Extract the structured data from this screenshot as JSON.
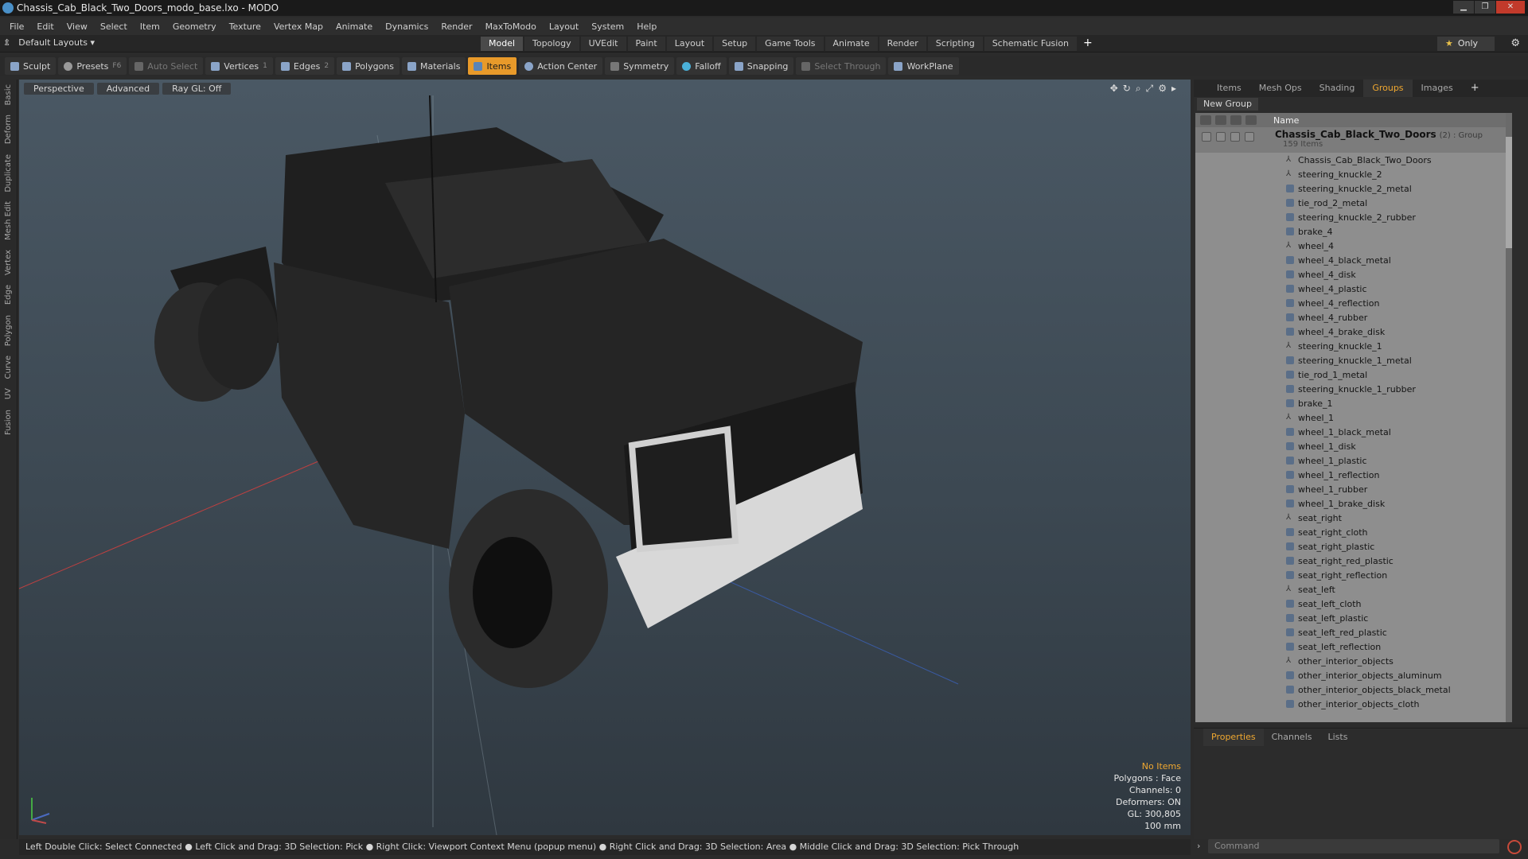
{
  "window": {
    "title": "Chassis_Cab_Black_Two_Doors_modo_base.lxo - MODO"
  },
  "menu": [
    "File",
    "Edit",
    "View",
    "Select",
    "Item",
    "Geometry",
    "Texture",
    "Vertex Map",
    "Animate",
    "Dynamics",
    "Render",
    "MaxToModo",
    "Layout",
    "System",
    "Help"
  ],
  "layout_bar": {
    "layouts_label": "Default Layouts ▾",
    "tabs": [
      "Model",
      "Topology",
      "UVEdit",
      "Paint",
      "Layout",
      "Setup",
      "Game Tools",
      "Animate",
      "Render",
      "Scripting",
      "Schematic Fusion"
    ],
    "active_tab": "Model",
    "only_label": "Only",
    "accent": "#f0a830"
  },
  "toolbar": {
    "sculpt": "Sculpt",
    "presets": "Presets",
    "presets_key": "F6",
    "auto_select": "Auto Select",
    "vertices": "Vertices",
    "vertices_key": "1",
    "edges": "Edges",
    "edges_key": "2",
    "polygons": "Polygons",
    "materials": "Materials",
    "items": "Items",
    "action_center": "Action Center",
    "symmetry": "Symmetry",
    "falloff": "Falloff",
    "snapping": "Snapping",
    "select_through": "Select Through",
    "workplane": "WorkPlane"
  },
  "left_strip": [
    "Basic",
    "Deform",
    "Duplicate",
    "Mesh Edit",
    "Vertex",
    "Edge",
    "Polygon",
    "Curve",
    "UV",
    "Fusion"
  ],
  "viewport": {
    "view": "Perspective",
    "shading": "Advanced",
    "raygl": "Ray GL: Off",
    "info": {
      "selection": "No Items",
      "polygons": "Polygons : Face",
      "channels": "Channels: 0",
      "deformers": "Deformers: ON",
      "gl": "GL: 300,805",
      "scale": "100 mm"
    }
  },
  "status_bar": "Left Double Click: Select Connected ● Left Click and Drag: 3D Selection: Pick ● Right Click: Viewport Context Menu (popup menu) ● Right Click and Drag: 3D Selection: Area ● Middle Click and Drag: 3D Selection: Pick Through",
  "right_panel": {
    "tabs": [
      "Items",
      "Mesh Ops",
      "Shading",
      "Groups",
      "Images"
    ],
    "active_tab": "Groups",
    "new_group": "New Group",
    "column_name": "Name",
    "group": {
      "name": "Chassis_Cab_Black_Two_Doors",
      "suffix": "(2) : Group",
      "count": "159 Items"
    },
    "items": [
      {
        "label": "Chassis_Cab_Black_Two_Doors",
        "kind": "locator"
      },
      {
        "label": "steering_knuckle_2",
        "kind": "locator"
      },
      {
        "label": "steering_knuckle_2_metal",
        "kind": "mesh"
      },
      {
        "label": "tie_rod_2_metal",
        "kind": "mesh"
      },
      {
        "label": "steering_knuckle_2_rubber",
        "kind": "mesh"
      },
      {
        "label": "brake_4",
        "kind": "mesh"
      },
      {
        "label": "wheel_4",
        "kind": "locator"
      },
      {
        "label": "wheel_4_black_metal",
        "kind": "mesh"
      },
      {
        "label": "wheel_4_disk",
        "kind": "mesh"
      },
      {
        "label": "wheel_4_plastic",
        "kind": "mesh"
      },
      {
        "label": "wheel_4_reflection",
        "kind": "mesh"
      },
      {
        "label": "wheel_4_rubber",
        "kind": "mesh"
      },
      {
        "label": "wheel_4_brake_disk",
        "kind": "mesh"
      },
      {
        "label": "steering_knuckle_1",
        "kind": "locator"
      },
      {
        "label": "steering_knuckle_1_metal",
        "kind": "mesh"
      },
      {
        "label": "tie_rod_1_metal",
        "kind": "mesh"
      },
      {
        "label": "steering_knuckle_1_rubber",
        "kind": "mesh"
      },
      {
        "label": "brake_1",
        "kind": "mesh"
      },
      {
        "label": "wheel_1",
        "kind": "locator"
      },
      {
        "label": "wheel_1_black_metal",
        "kind": "mesh"
      },
      {
        "label": "wheel_1_disk",
        "kind": "mesh"
      },
      {
        "label": "wheel_1_plastic",
        "kind": "mesh"
      },
      {
        "label": "wheel_1_reflection",
        "kind": "mesh"
      },
      {
        "label": "wheel_1_rubber",
        "kind": "mesh"
      },
      {
        "label": "wheel_1_brake_disk",
        "kind": "mesh"
      },
      {
        "label": "seat_right",
        "kind": "locator"
      },
      {
        "label": "seat_right_cloth",
        "kind": "mesh"
      },
      {
        "label": "seat_right_plastic",
        "kind": "mesh"
      },
      {
        "label": "seat_right_red_plastic",
        "kind": "mesh"
      },
      {
        "label": "seat_right_reflection",
        "kind": "mesh"
      },
      {
        "label": "seat_left",
        "kind": "locator"
      },
      {
        "label": "seat_left_cloth",
        "kind": "mesh"
      },
      {
        "label": "seat_left_plastic",
        "kind": "mesh"
      },
      {
        "label": "seat_left_red_plastic",
        "kind": "mesh"
      },
      {
        "label": "seat_left_reflection",
        "kind": "mesh"
      },
      {
        "label": "other_interior_objects",
        "kind": "locator"
      },
      {
        "label": "other_interior_objects_aluminum",
        "kind": "mesh"
      },
      {
        "label": "other_interior_objects_black_metal",
        "kind": "mesh"
      },
      {
        "label": "other_interior_objects_cloth",
        "kind": "mesh"
      }
    ]
  },
  "properties_panel": {
    "tabs": [
      "Properties",
      "Channels",
      "Lists"
    ],
    "active_tab": "Properties"
  },
  "command": {
    "placeholder": "Command"
  }
}
